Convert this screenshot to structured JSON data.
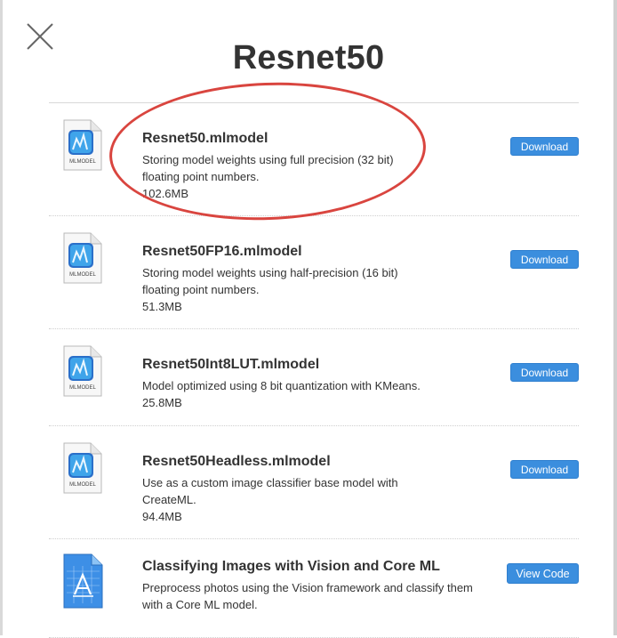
{
  "page": {
    "title": "Resnet50",
    "close_icon": "close-icon"
  },
  "models": [
    {
      "name": "Resnet50.mlmodel",
      "lines": [
        "Storing model weights using full precision (32 bit)",
        "floating point numbers.",
        "102.6MB"
      ],
      "icon": "mlmodel-file-icon",
      "icon_label": "MLMODEL",
      "button": "Download"
    },
    {
      "name": "Resnet50FP16.mlmodel",
      "lines": [
        "Storing model weights using half-precision (16 bit)",
        "floating point numbers.",
        "51.3MB"
      ],
      "icon": "mlmodel-file-icon",
      "icon_label": "MLMODEL",
      "button": "Download"
    },
    {
      "name": "Resnet50Int8LUT.mlmodel",
      "lines": [
        "Model optimized using 8 bit quantization with KMeans.",
        "25.8MB"
      ],
      "icon": "mlmodel-file-icon",
      "icon_label": "MLMODEL",
      "button": "Download"
    },
    {
      "name": "Resnet50Headless.mlmodel",
      "lines": [
        "Use as a custom image classifier base model with",
        "CreateML.",
        "94.4MB"
      ],
      "icon": "mlmodel-file-icon",
      "icon_label": "MLMODEL",
      "button": "Download"
    },
    {
      "name": "Classifying Images with Vision and Core ML",
      "lines": [
        "Preprocess photos using the Vision framework and classify them",
        "with a Core ML model."
      ],
      "icon": "xcode-project-icon",
      "button": "View Code"
    }
  ],
  "colors": {
    "accent": "#3b8ede",
    "annotation": "#d9453f"
  }
}
